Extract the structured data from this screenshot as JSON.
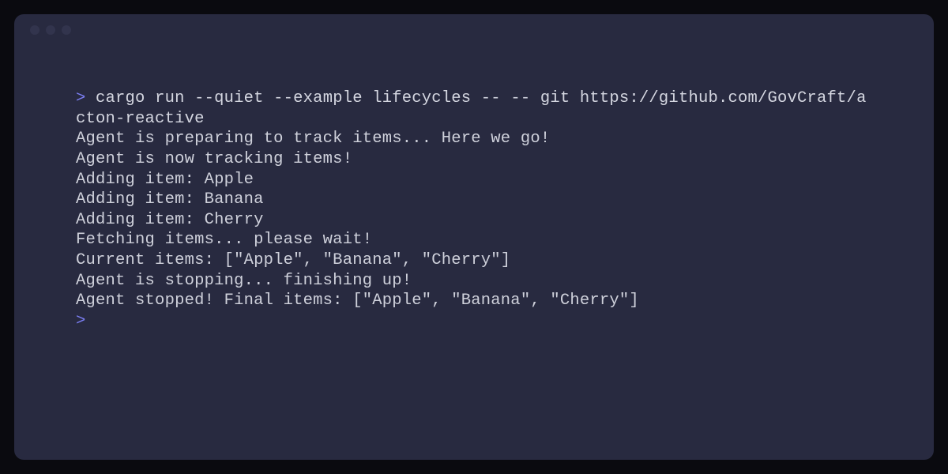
{
  "terminal": {
    "prompt": ">",
    "command": "cargo run --quiet --example lifecycles -- -- git https://github.com/GovCraft/acton-reactive",
    "lines": [
      "Agent is preparing to track items... Here we go!",
      "Agent is now tracking items!",
      "Adding item: Apple",
      "Adding item: Banana",
      "Adding item: Cherry",
      "Fetching items... please wait!",
      "Current items: [\"Apple\", \"Banana\", \"Cherry\"]",
      "Agent is stopping... finishing up!",
      "Agent stopped! Final items: [\"Apple\", \"Banana\", \"Cherry\"]"
    ],
    "final_prompt": ">"
  },
  "colors": {
    "bg_outer": "#0a0a0f",
    "bg_terminal": "#282a40",
    "text": "#d4d6e0",
    "prompt": "#7c7ff5"
  }
}
